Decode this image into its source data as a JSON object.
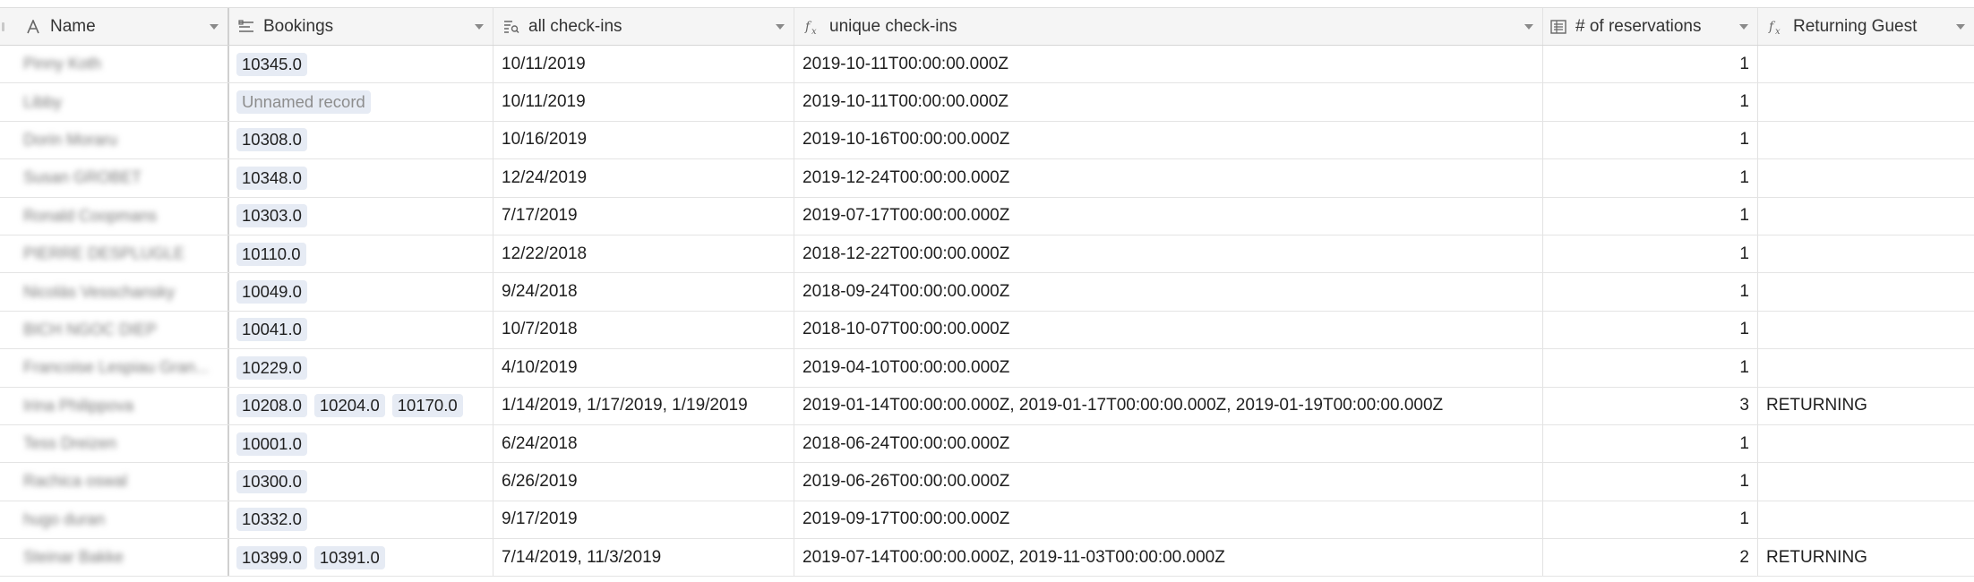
{
  "columns": {
    "name": {
      "label": "Name",
      "icon": "text-field-icon"
    },
    "bookings": {
      "label": "Bookings",
      "icon": "linked-record-icon"
    },
    "all_checkins": {
      "label": "all check-ins",
      "icon": "lookup-icon"
    },
    "unique_checkins": {
      "label": "unique check-ins",
      "icon": "formula-icon"
    },
    "reservations": {
      "label": "# of reservations",
      "icon": "count-icon"
    },
    "returning": {
      "label": "Returning Guest",
      "icon": "formula-icon"
    }
  },
  "rows": [
    {
      "name": "Pinny Koth",
      "bookings": [
        "10345.0"
      ],
      "all": "10/11/2019",
      "unique": "2019-10-11T00:00:00.000Z",
      "res": "1",
      "ret": ""
    },
    {
      "name": "Libby",
      "bookings": [
        "Unnamed record"
      ],
      "all": "10/11/2019",
      "unique": "2019-10-11T00:00:00.000Z",
      "res": "1",
      "ret": ""
    },
    {
      "name": "Dorin Moraru",
      "bookings": [
        "10308.0"
      ],
      "all": "10/16/2019",
      "unique": "2019-10-16T00:00:00.000Z",
      "res": "1",
      "ret": ""
    },
    {
      "name": "Susan GROBET",
      "bookings": [
        "10348.0"
      ],
      "all": "12/24/2019",
      "unique": "2019-12-24T00:00:00.000Z",
      "res": "1",
      "ret": ""
    },
    {
      "name": "Ronald Coopmans",
      "bookings": [
        "10303.0"
      ],
      "all": "7/17/2019",
      "unique": "2019-07-17T00:00:00.000Z",
      "res": "1",
      "ret": ""
    },
    {
      "name": "PIERRE DESPLUGLE",
      "bookings": [
        "10110.0"
      ],
      "all": "12/22/2018",
      "unique": "2018-12-22T00:00:00.000Z",
      "res": "1",
      "ret": ""
    },
    {
      "name": "Nicolás Vesschansky",
      "bookings": [
        "10049.0"
      ],
      "all": "9/24/2018",
      "unique": "2018-09-24T00:00:00.000Z",
      "res": "1",
      "ret": ""
    },
    {
      "name": "BICH NGOC DIEP",
      "bookings": [
        "10041.0"
      ],
      "all": "10/7/2018",
      "unique": "2018-10-07T00:00:00.000Z",
      "res": "1",
      "ret": ""
    },
    {
      "name": "Francoise Lespiau Gran...",
      "bookings": [
        "10229.0"
      ],
      "all": "4/10/2019",
      "unique": "2019-04-10T00:00:00.000Z",
      "res": "1",
      "ret": ""
    },
    {
      "name": "Irina Philippova",
      "bookings": [
        "10208.0",
        "10204.0",
        "10170.0"
      ],
      "all": "1/14/2019, 1/17/2019, 1/19/2019",
      "unique": "2019-01-14T00:00:00.000Z, 2019-01-17T00:00:00.000Z, 2019-01-19T00:00:00.000Z",
      "res": "3",
      "ret": "RETURNING"
    },
    {
      "name": "Tess Dreizen",
      "bookings": [
        "10001.0"
      ],
      "all": "6/24/2018",
      "unique": "2018-06-24T00:00:00.000Z",
      "res": "1",
      "ret": ""
    },
    {
      "name": "Rachica oswal",
      "bookings": [
        "10300.0"
      ],
      "all": "6/26/2019",
      "unique": "2019-06-26T00:00:00.000Z",
      "res": "1",
      "ret": ""
    },
    {
      "name": "hugo duran",
      "bookings": [
        "10332.0"
      ],
      "all": "9/17/2019",
      "unique": "2019-09-17T00:00:00.000Z",
      "res": "1",
      "ret": ""
    },
    {
      "name": "Steinar Bakke",
      "bookings": [
        "10399.0",
        "10391.0"
      ],
      "all": "7/14/2019, 11/3/2019",
      "unique": "2019-07-14T00:00:00.000Z, 2019-11-03T00:00:00.000Z",
      "res": "2",
      "ret": "RETURNING"
    }
  ]
}
